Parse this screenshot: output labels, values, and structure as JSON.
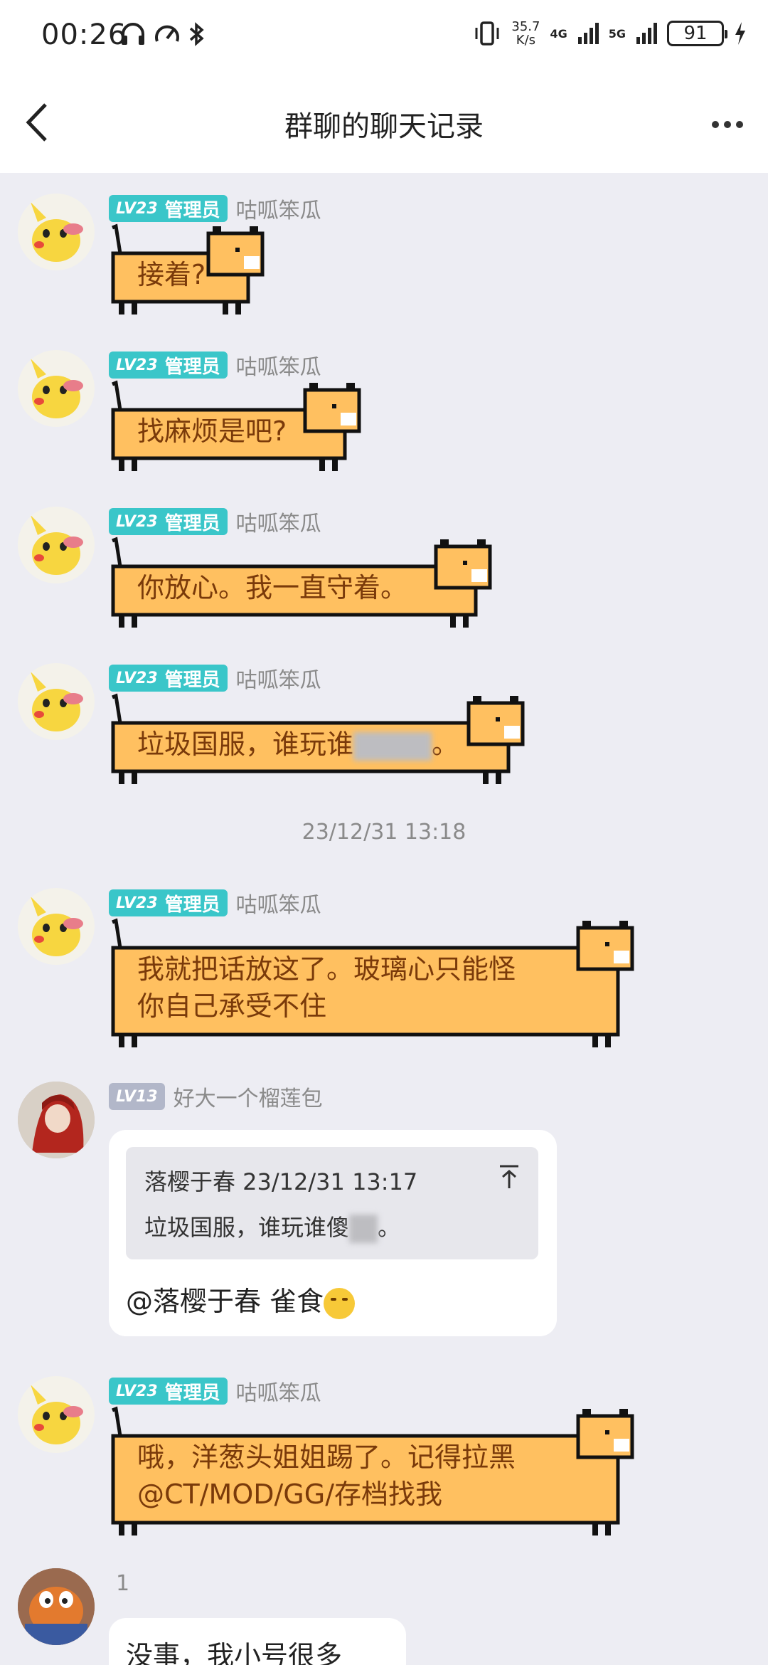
{
  "status_bar": {
    "time": "00:26",
    "net_speed_value": "35.7",
    "net_speed_unit": "K/s",
    "net_4g": "4G",
    "net_5g": "5G",
    "battery": "91"
  },
  "header": {
    "title": "群聊的聊天记录"
  },
  "messages": [
    {
      "level": "LV23",
      "role": "管理员",
      "sender": "咕呱笨瓜",
      "lines": [
        "接着?"
      ]
    },
    {
      "level": "LV23",
      "role": "管理员",
      "sender": "咕呱笨瓜",
      "lines": [
        "找麻烦是吧?"
      ]
    },
    {
      "level": "LV23",
      "role": "管理员",
      "sender": "咕呱笨瓜",
      "lines": [
        "你放心。我一直守着。"
      ]
    },
    {
      "level": "LV23",
      "role": "管理员",
      "sender": "咕呱笨瓜",
      "lines_pre": "垃圾国服，谁玩谁",
      "lines_post": "。"
    },
    {
      "level": "LV23",
      "role": "管理员",
      "sender": "咕呱笨瓜",
      "lines": [
        "我就把话放这了。玻璃心只能怪",
        "你自己承受不住"
      ]
    },
    {
      "level": "LV13",
      "sender": "好大一个榴莲包",
      "quote_head": "落樱于春 23/12/31 13:17",
      "quote_pre": "垃圾国服，谁玩谁傻",
      "quote_post": "。",
      "reply": "@落樱于春 雀食"
    },
    {
      "level": "LV23",
      "role": "管理员",
      "sender": "咕呱笨瓜",
      "lines": [
        "哦，洋葱头姐姐踢了。记得拉黑",
        "@CT/MOD/GG/存档找我"
      ]
    },
    {
      "sender": "1",
      "reply": "没事，我小号很多"
    }
  ],
  "time_divider": "23/12/31 13:18",
  "colors": {
    "cat_fill": "#ffc060",
    "cat_text": "#7a3a0a",
    "level_admin": "#3ac6c9",
    "level_member": "#b2b7c9",
    "background": "#ededf3"
  }
}
